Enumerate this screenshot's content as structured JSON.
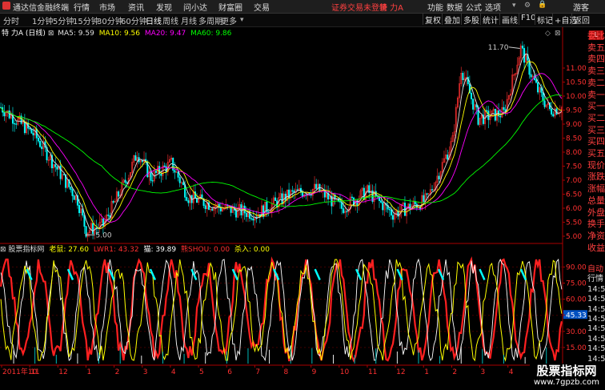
{
  "menubar": {
    "app_name": "通达信金融终端",
    "items": [
      "行情",
      "市场",
      "资讯",
      "发现",
      "问小达",
      "财富圈",
      "交易"
    ],
    "login_status": "证券交易未登录",
    "stock_name": "特 力A",
    "right_items": [
      "功能",
      "数据",
      "公式",
      "选项"
    ],
    "user": "游客"
  },
  "toolbar": {
    "periods": [
      "分时",
      "1分钟",
      "5分钟",
      "15分钟",
      "30分钟",
      "60分钟",
      "日线",
      "周线",
      "月线",
      "多周期",
      "更多"
    ],
    "active_period": "日线",
    "buttons": [
      "复权",
      "叠加",
      "多股",
      "统计",
      "画线",
      "F10",
      "标记",
      "+自选",
      "返回"
    ]
  },
  "main_chart": {
    "stock": "特 力A",
    "period": "(日线)",
    "ma": [
      {
        "label": "MA5: 9.59",
        "color": "#e0e0e0"
      },
      {
        "label": "MA10: 9.56",
        "color": "#ffff00"
      },
      {
        "label": "MA20: 9.47",
        "color": "#ff00ff"
      },
      {
        "label": "MA60: 9.86",
        "color": "#00ff00"
      }
    ],
    "high_label": "11.70",
    "low_label": "5.00",
    "y_ticks": [
      "11.00",
      "10.50",
      "10.00",
      "9.50",
      "9.00",
      "8.50",
      "8.00",
      "7.50",
      "7.00",
      "6.50",
      "6.00",
      "5.50",
      "5.00"
    ],
    "y_range": [
      4.8,
      12.0
    ]
  },
  "indicator": {
    "name": "股票指标网",
    "values": [
      {
        "label": "老鼠: 27.60",
        "color": "#ffff00"
      },
      {
        "label": "LWR1: 43.32",
        "color": "#ff3030"
      },
      {
        "label": "猫: 39.89",
        "color": "#ffffff"
      },
      {
        "label": "熊SHOU: 0.00",
        "color": "#ff3030"
      },
      {
        "label": "杀入: 0.00",
        "color": "#ffff00"
      }
    ],
    "y_ticks": [
      "90.00",
      "75.00",
      "60.00",
      "45.33",
      "30.00",
      "15.00"
    ],
    "current_value": "45.33"
  },
  "x_axis": {
    "labels": [
      "2011年10",
      "11",
      "12",
      "1",
      "2",
      "3",
      "4",
      "5",
      "6",
      "7",
      "8",
      "9",
      "10",
      "11",
      "12",
      "1",
      "2",
      "3",
      "4",
      "5"
    ]
  },
  "side_panel": {
    "badge": "L",
    "items": [
      {
        "text": "委比",
        "white": false
      },
      {
        "text": "卖五",
        "white": false
      },
      {
        "text": "卖四",
        "white": false
      },
      {
        "text": "卖三",
        "white": false
      },
      {
        "text": "卖二",
        "white": false
      },
      {
        "text": "卖一",
        "white": false
      },
      {
        "text": "买一",
        "white": false
      },
      {
        "text": "买二",
        "white": false
      },
      {
        "text": "买三",
        "white": false
      },
      {
        "text": "买四",
        "white": false
      },
      {
        "text": "买五",
        "white": false
      },
      {
        "text": "现价",
        "white": false
      },
      {
        "text": "涨跌",
        "white": false
      },
      {
        "text": "涨幅",
        "white": false
      },
      {
        "text": "总量",
        "white": false
      },
      {
        "text": "外盘",
        "white": false
      },
      {
        "text": "换手",
        "white": false
      },
      {
        "text": "净资",
        "white": false
      },
      {
        "text": "收益",
        "white": false
      }
    ],
    "tail": [
      {
        "text": "自动",
        "white": false
      },
      {
        "text": "行情",
        "white": true
      },
      {
        "text": "14:56",
        "white": true
      },
      {
        "text": "14:56",
        "white": true
      },
      {
        "text": "14:56",
        "white": true
      },
      {
        "text": "14:56",
        "white": true
      },
      {
        "text": "14:56",
        "white": true
      },
      {
        "text": "14:56",
        "white": true
      },
      {
        "text": "14:56",
        "white": true
      },
      {
        "text": "14:56",
        "white": true
      }
    ]
  },
  "watermark": {
    "line1": "股票指标网",
    "line2": "www.7gpzb.com"
  }
}
